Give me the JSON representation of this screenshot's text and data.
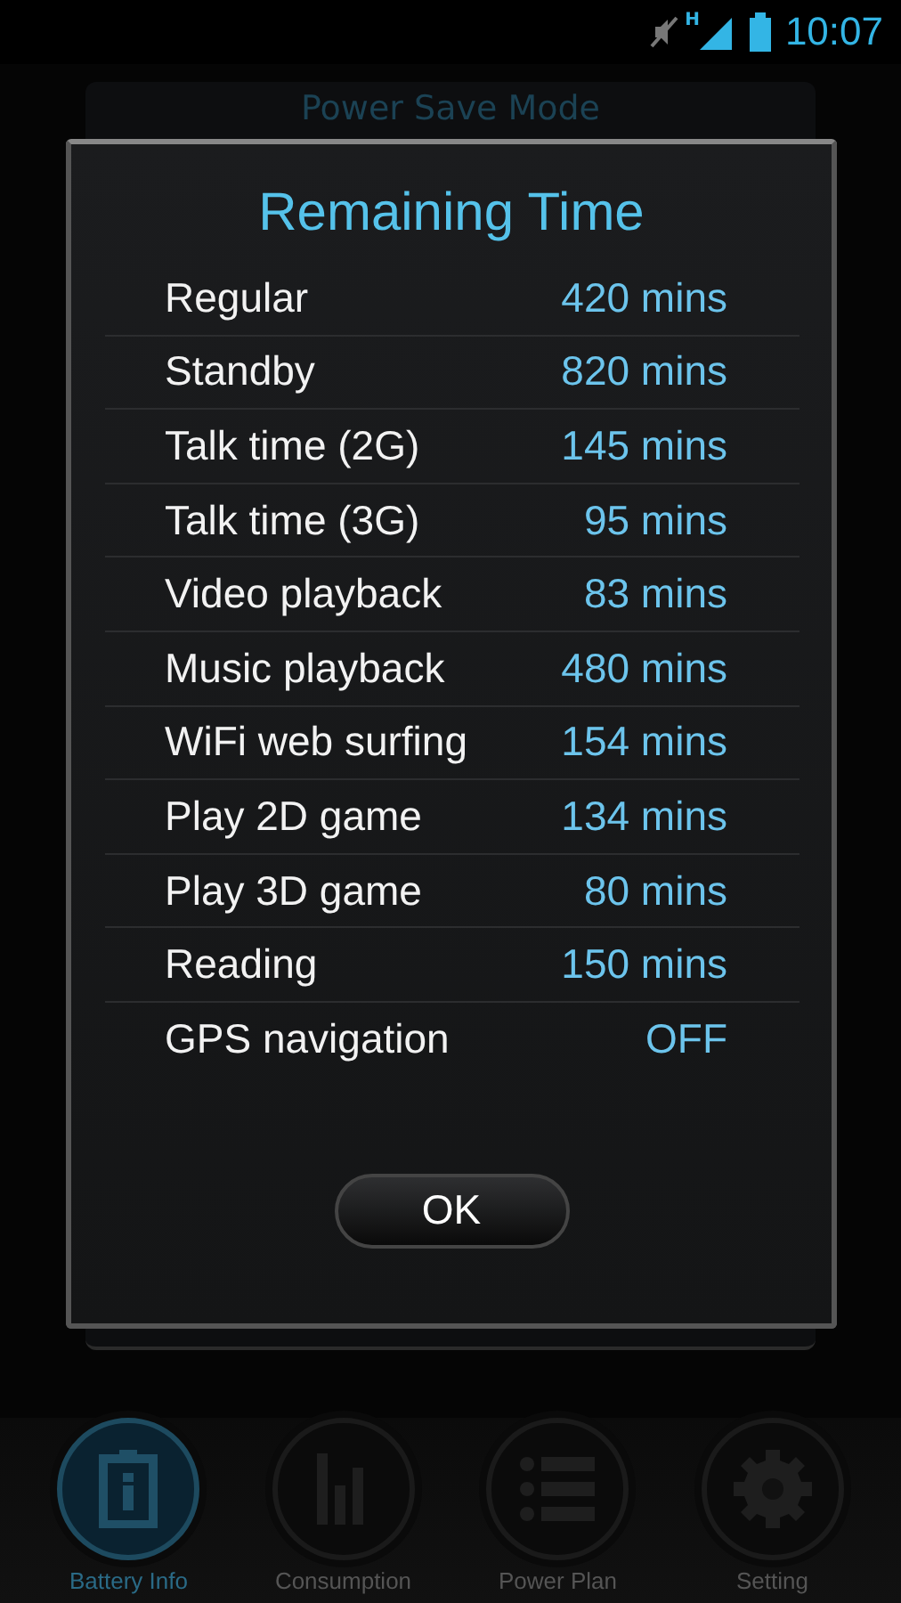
{
  "status_bar": {
    "network_type": "H",
    "time": "10:07"
  },
  "background_panel": {
    "title": "Power Save Mode"
  },
  "dialog": {
    "title": "Remaining Time",
    "rows": [
      {
        "label": "Regular",
        "value": "420 mins"
      },
      {
        "label": "Standby",
        "value": "820 mins"
      },
      {
        "label": "Talk time (2G)",
        "value": "145 mins"
      },
      {
        "label": "Talk time (3G)",
        "value": "95 mins"
      },
      {
        "label": "Video playback",
        "value": "83 mins"
      },
      {
        "label": "Music playback",
        "value": "480 mins"
      },
      {
        "label": "WiFi web surfing",
        "value": "154 mins"
      },
      {
        "label": "Play 2D game",
        "value": "134 mins"
      },
      {
        "label": "Play 3D game",
        "value": "80 mins"
      },
      {
        "label": "Reading",
        "value": "150 mins"
      },
      {
        "label": "GPS navigation",
        "value": "OFF"
      }
    ],
    "button": "OK"
  },
  "nav": [
    {
      "label": "Battery Info",
      "kind": "battery",
      "selected": true
    },
    {
      "label": "Consumption",
      "kind": "bars",
      "selected": false
    },
    {
      "label": "Power Plan",
      "kind": "list",
      "selected": false
    },
    {
      "label": "Setting",
      "kind": "gear",
      "selected": false
    }
  ]
}
